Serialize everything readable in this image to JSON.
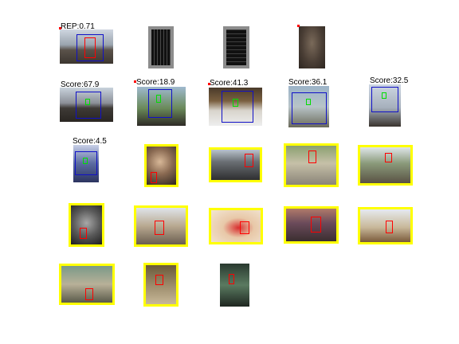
{
  "figure": {
    "row1": {
      "rep_label": "REP:0.71"
    },
    "row2": {
      "scores": [
        "Score:67.9",
        "Score:18.9",
        "Score:41.3",
        "Score:36.1",
        "Score:32.5"
      ]
    },
    "row3": {
      "score": "Score:4.5"
    }
  },
  "colors": {
    "highlight_border": "#ffff00",
    "detection_box": "#ff0000",
    "part_box": "#1010c8",
    "model_frame": "#8c8c8c"
  }
}
